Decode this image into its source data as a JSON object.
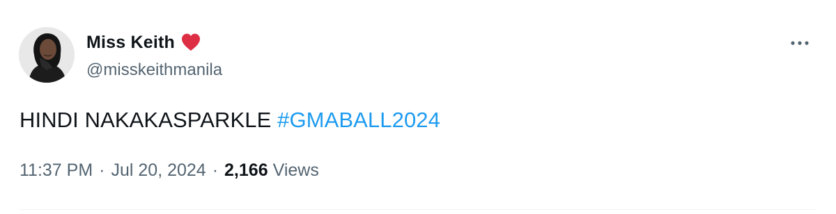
{
  "tweet": {
    "author": {
      "display_name": "Miss Keith",
      "emoji": "heart-emoji",
      "handle": "@misskeithmanila"
    },
    "text": "HINDI NAKAKASPARKLE",
    "hashtag": "#GMABALL2024",
    "time": "11:37 PM",
    "date": "Jul 20, 2024",
    "separator": "·",
    "views_count": "2,166",
    "views_label": "Views"
  },
  "colors": {
    "text": "#0f1419",
    "secondary": "#536471",
    "link": "#1d9bf0",
    "heart": "#f91880",
    "divider": "#eff3f4"
  },
  "icons": {
    "more": "more-horizontal-icon",
    "heart": "red-heart-emoji"
  }
}
